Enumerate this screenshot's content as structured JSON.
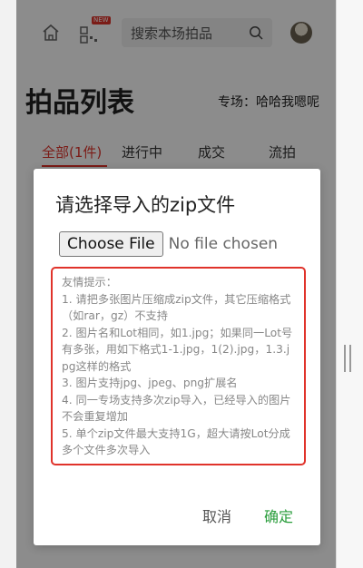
{
  "header": {
    "home_icon": "home-icon",
    "qr_icon": "qr-code-icon",
    "new_badge": "NEW",
    "search_placeholder": "搜索本场拍品",
    "search_icon": "search-icon"
  },
  "page": {
    "title": "拍品列表",
    "session_label": "专场：哈哈我嗯呢"
  },
  "tabs": [
    {
      "label": "全部(1件)",
      "active": true
    },
    {
      "label": "进行中",
      "active": false
    },
    {
      "label": "成交",
      "active": false
    },
    {
      "label": "流拍",
      "active": false
    }
  ],
  "modal": {
    "title": "请选择导入的zip文件",
    "choose_button": "Choose File",
    "file_status": "No file chosen",
    "tips": [
      "友情提示：",
      "1. 请把多张图片压缩成zip文件，其它压缩格式（如rar，gz）不支持",
      "2. 图片名和Lot相同，如1.jpg；如果同一Lot号有多张，用如下格式1-1.jpg，1(2).jpg，1.3.jpg这样的格式",
      "3. 图片支持jpg、jpeg、png扩展名",
      "4. 同一专场支持多次zip导入，已经导入的图片不会重复增加",
      "5. 单个zip文件最大支持1G，超大请按Lot分成多个文件多次导入"
    ],
    "cancel_label": "取消",
    "confirm_label": "确定"
  },
  "colors": {
    "accent_red": "#e0332b",
    "confirm_green": "#2a9d3c"
  }
}
